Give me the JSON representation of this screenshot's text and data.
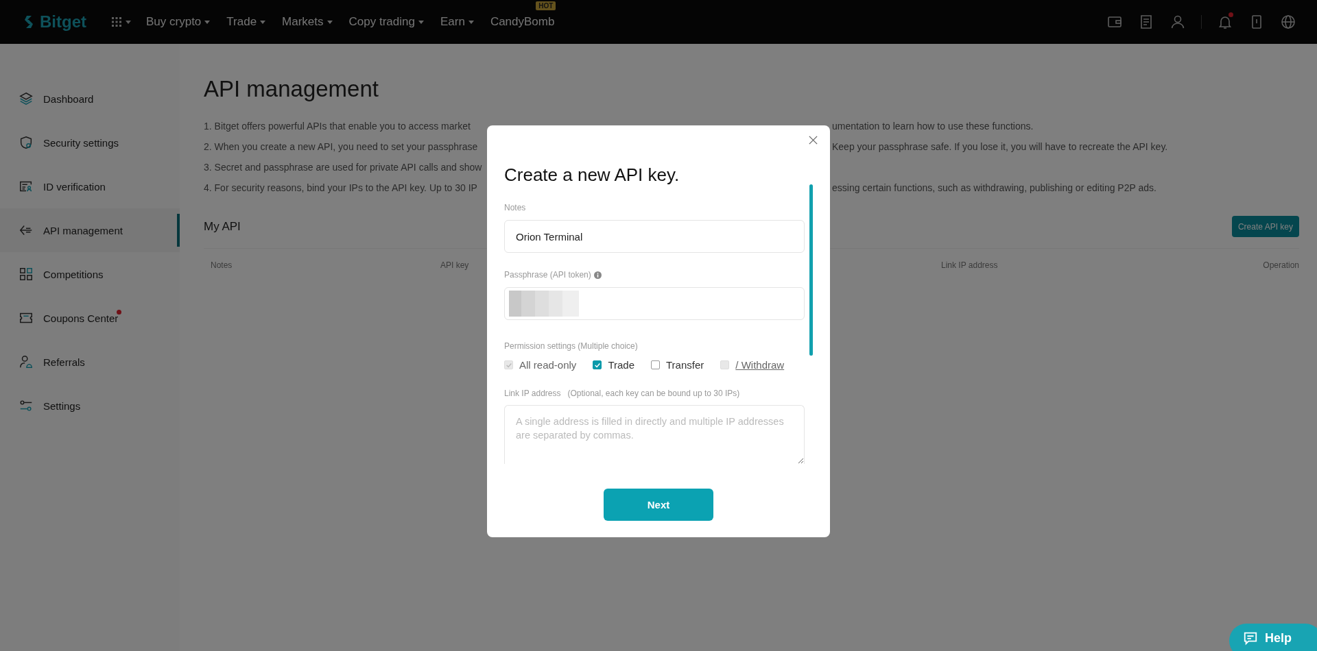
{
  "topbar": {
    "logo": "Bitget",
    "menu": [
      {
        "label": "Buy crypto",
        "dropdown": true
      },
      {
        "label": "Trade",
        "dropdown": true
      },
      {
        "label": "Markets",
        "dropdown": true
      },
      {
        "label": "Copy trading",
        "dropdown": true
      },
      {
        "label": "Earn",
        "dropdown": true
      },
      {
        "label": "CandyBomb",
        "dropdown": false,
        "badge": "HOT"
      }
    ],
    "notification_dot": true
  },
  "sidebar": {
    "items": [
      {
        "label": "Dashboard",
        "selected": false,
        "dot": false
      },
      {
        "label": "Security settings",
        "selected": false,
        "dot": false
      },
      {
        "label": "ID verification",
        "selected": false,
        "dot": false
      },
      {
        "label": "API management",
        "selected": true,
        "dot": false
      },
      {
        "label": "Competitions",
        "selected": false,
        "dot": false
      },
      {
        "label": "Coupons Center",
        "selected": false,
        "dot": true
      },
      {
        "label": "Referrals",
        "selected": false,
        "dot": false
      },
      {
        "label": "Settings",
        "selected": false,
        "dot": false
      }
    ]
  },
  "page": {
    "title": "API management",
    "intro": [
      {
        "left": "1. Bitget offers powerful APIs that enable you to access market",
        "right": "umentation to learn how to use these functions."
      },
      {
        "left": "2. When you create a new API, you need to set your passphrase",
        "right": "Keep your passphrase safe. If you lose it, you will have to recreate the API key."
      },
      {
        "left": "3. Secret and passphrase are used for private API calls and show"
      },
      {
        "left": "4. For security reasons, bind your IPs to the API key. Up to 30 IP",
        "right": "essing certain functions, such as withdrawing, publishing or editing P2P ads."
      }
    ],
    "my_api": "My API",
    "create_button": "Create API key",
    "columns": [
      "Notes",
      "API key",
      "Link IP address",
      "Operation"
    ]
  },
  "modal": {
    "title": "Create a new API key.",
    "notes_label": "Notes",
    "notes_value": "Orion Terminal",
    "passphrase_label": "Passphrase (API token)",
    "permission_label": "Permission settings (Multiple choice)",
    "permissions": [
      {
        "label": "All read-only",
        "checked": true,
        "disabled": true,
        "underlined": false
      },
      {
        "label": "Trade",
        "checked": true,
        "disabled": false,
        "underlined": false
      },
      {
        "label": "Transfer",
        "checked": false,
        "disabled": false,
        "underlined": false
      },
      {
        "label": "/ Withdraw",
        "checked": false,
        "disabled": true,
        "underlined": true
      }
    ],
    "ip_label": "Link IP address",
    "ip_hint": "(Optional, each key can be bound up to 30 IPs)",
    "ip_placeholder": "A single address is filled in directly and multiple IP addresses are separated by commas.",
    "next_button": "Next"
  },
  "help_button": "Help"
}
